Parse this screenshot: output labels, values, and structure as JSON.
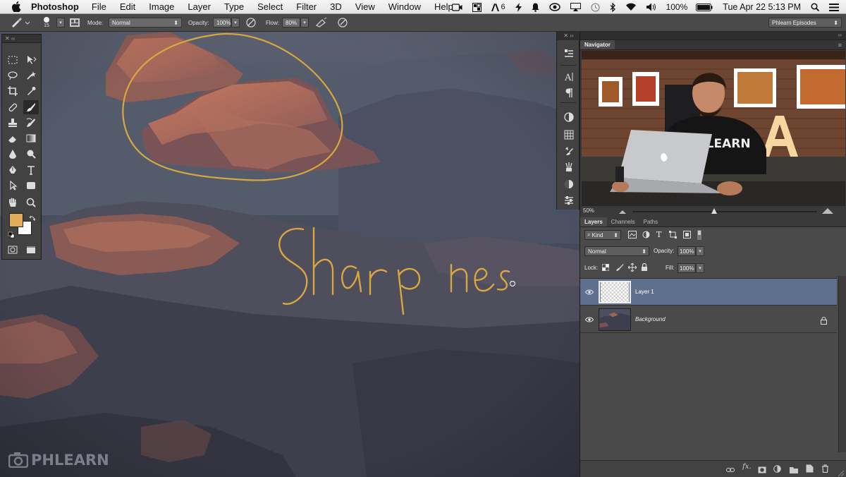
{
  "menubar": {
    "app_name": "Photoshop",
    "menus": [
      "File",
      "Edit",
      "Image",
      "Layer",
      "Type",
      "Select",
      "Filter",
      "3D",
      "View",
      "Window",
      "Help"
    ],
    "adobe_badge": "6",
    "battery": "100%",
    "datetime": "Tue Apr 22  5:13 PM"
  },
  "options_bar": {
    "brush_size": "15",
    "mode_label": "Mode:",
    "mode_value": "Normal",
    "opacity_label": "Opacity:",
    "opacity_value": "100%",
    "flow_label": "Flow:",
    "flow_value": "80%",
    "workspace": "Phlearn Episodes"
  },
  "canvas": {
    "annotation_text": "Sharp nes",
    "watermark": "PHLEARN",
    "annotation_color": "#d8a83e"
  },
  "tools_panel": {
    "foreground_color": "#e2ac58",
    "background_color": "#ffffff"
  },
  "navigator": {
    "tab": "Navigator",
    "zoom": "50%",
    "video_shirt_text": "PHLEARN"
  },
  "layers_panel": {
    "tabs": [
      "Layers",
      "Channels",
      "Paths"
    ],
    "filter_kind": "Kind",
    "blend_mode": "Normal",
    "opacity_label": "Opacity:",
    "opacity_value": "100%",
    "lock_label": "Lock:",
    "fill_label": "Fill:",
    "fill_value": "100%",
    "layers": [
      {
        "name": "Layer 1",
        "selected": true
      },
      {
        "name": "Background",
        "selected": false,
        "locked": true
      }
    ]
  }
}
